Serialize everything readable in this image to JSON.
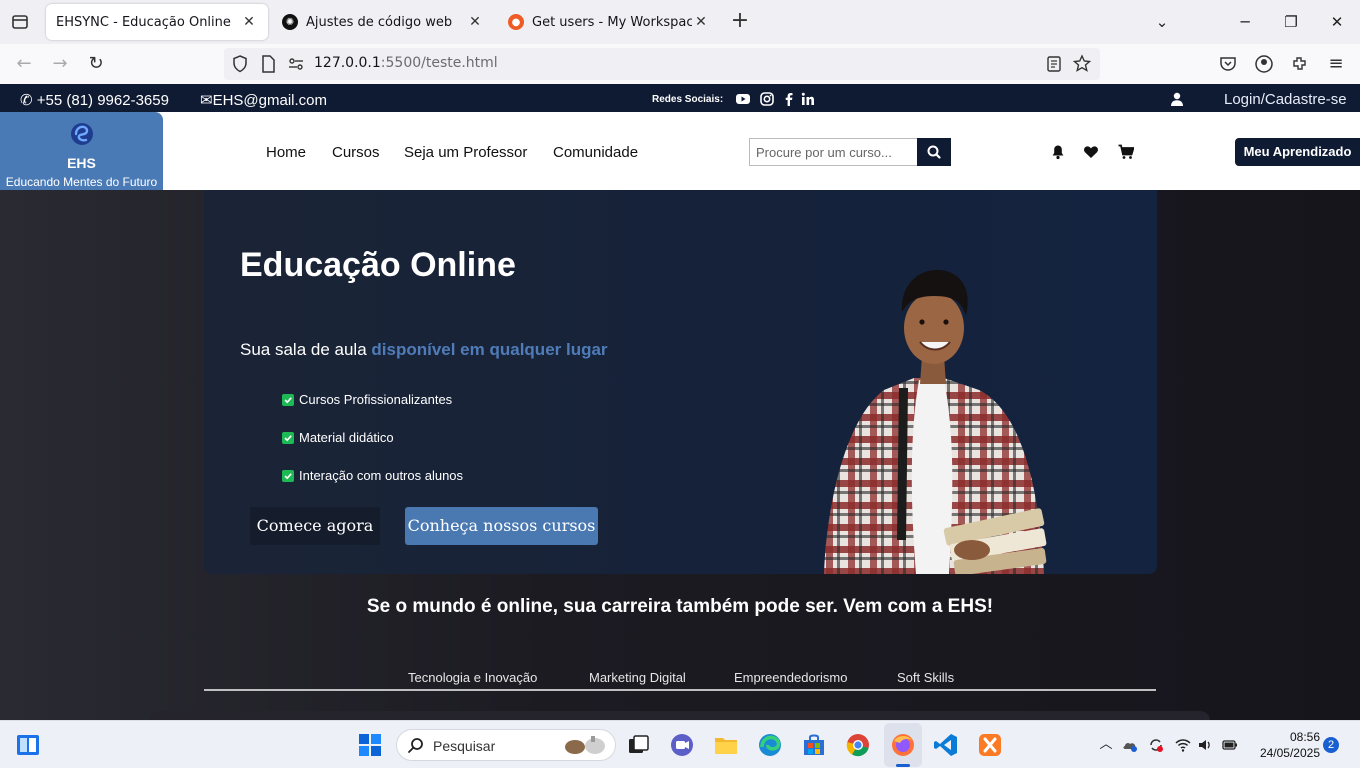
{
  "browser": {
    "tabs": [
      {
        "title": "EHSYNC - Educação Online",
        "active": true
      },
      {
        "title": "Ajustes de código web",
        "active": false
      },
      {
        "title": "Get users - My Workspace",
        "active": false
      }
    ],
    "url_host": "127.0.0.1",
    "url_rest": ":5500/teste.html"
  },
  "topbar": {
    "phone": "+55 (81) 9962-3659",
    "email": "EHS@gmail.com",
    "social_label": "Redes Sociais:",
    "login": "Login/Cadastre-se"
  },
  "header": {
    "brand": "EHS",
    "tagline": "Educando Mentes do Futuro",
    "nav": [
      "Home",
      "Cursos",
      "Seja um Professor",
      "Comunidade"
    ],
    "search_placeholder": "Procure por um curso...",
    "learning_button": "Meu Aprendizado"
  },
  "hero": {
    "title": "Educação Online",
    "subtitle_prefix": "Sua sala de aula ",
    "subtitle_highlight": "disponível em qualquer lugar",
    "features": [
      "Cursos Profissionalizantes",
      "Material didático",
      "Interação com outros alunos"
    ],
    "cta_primary": "Comece agora",
    "cta_secondary": "Conheça nossos cursos"
  },
  "slogan": "Se o mundo é online, sua carreira também pode ser. Vem com a EHS!",
  "categories": [
    "Tecnologia e Inovação",
    "Marketing Digital",
    "Empreendedorismo",
    "Soft Skills"
  ],
  "taskbar": {
    "search_placeholder": "Pesquisar",
    "time": "08:56",
    "date": "24/05/2025",
    "notifications": "2"
  },
  "colors": {
    "navy": "#0f1a33",
    "accent_blue": "#4a79b2",
    "check_green": "#1db954"
  }
}
